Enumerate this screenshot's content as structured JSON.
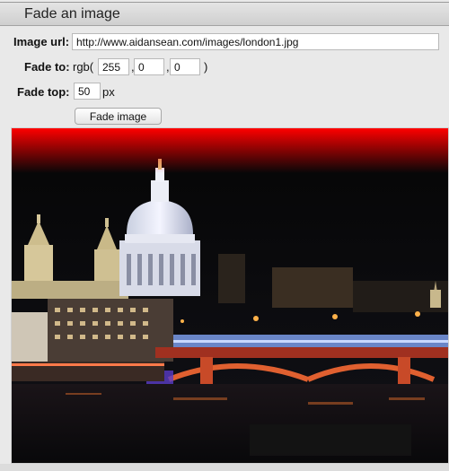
{
  "panel": {
    "title": "Fade an image"
  },
  "form": {
    "image_url_label": "Image url:",
    "image_url_value": "http://www.aidansean.com/images/london1.jpg",
    "fade_to_label": "Fade to:",
    "rgb_prefix": "rgb(",
    "rgb_r": "255",
    "rgb_g": "0",
    "rgb_b": "0",
    "comma": ",",
    "rgb_suffix": ")",
    "fade_top_label": "Fade top:",
    "fade_top_value": "50",
    "fade_top_unit": "px",
    "submit_label": "Fade image"
  },
  "image": {
    "fade_color": "#ff0000"
  }
}
